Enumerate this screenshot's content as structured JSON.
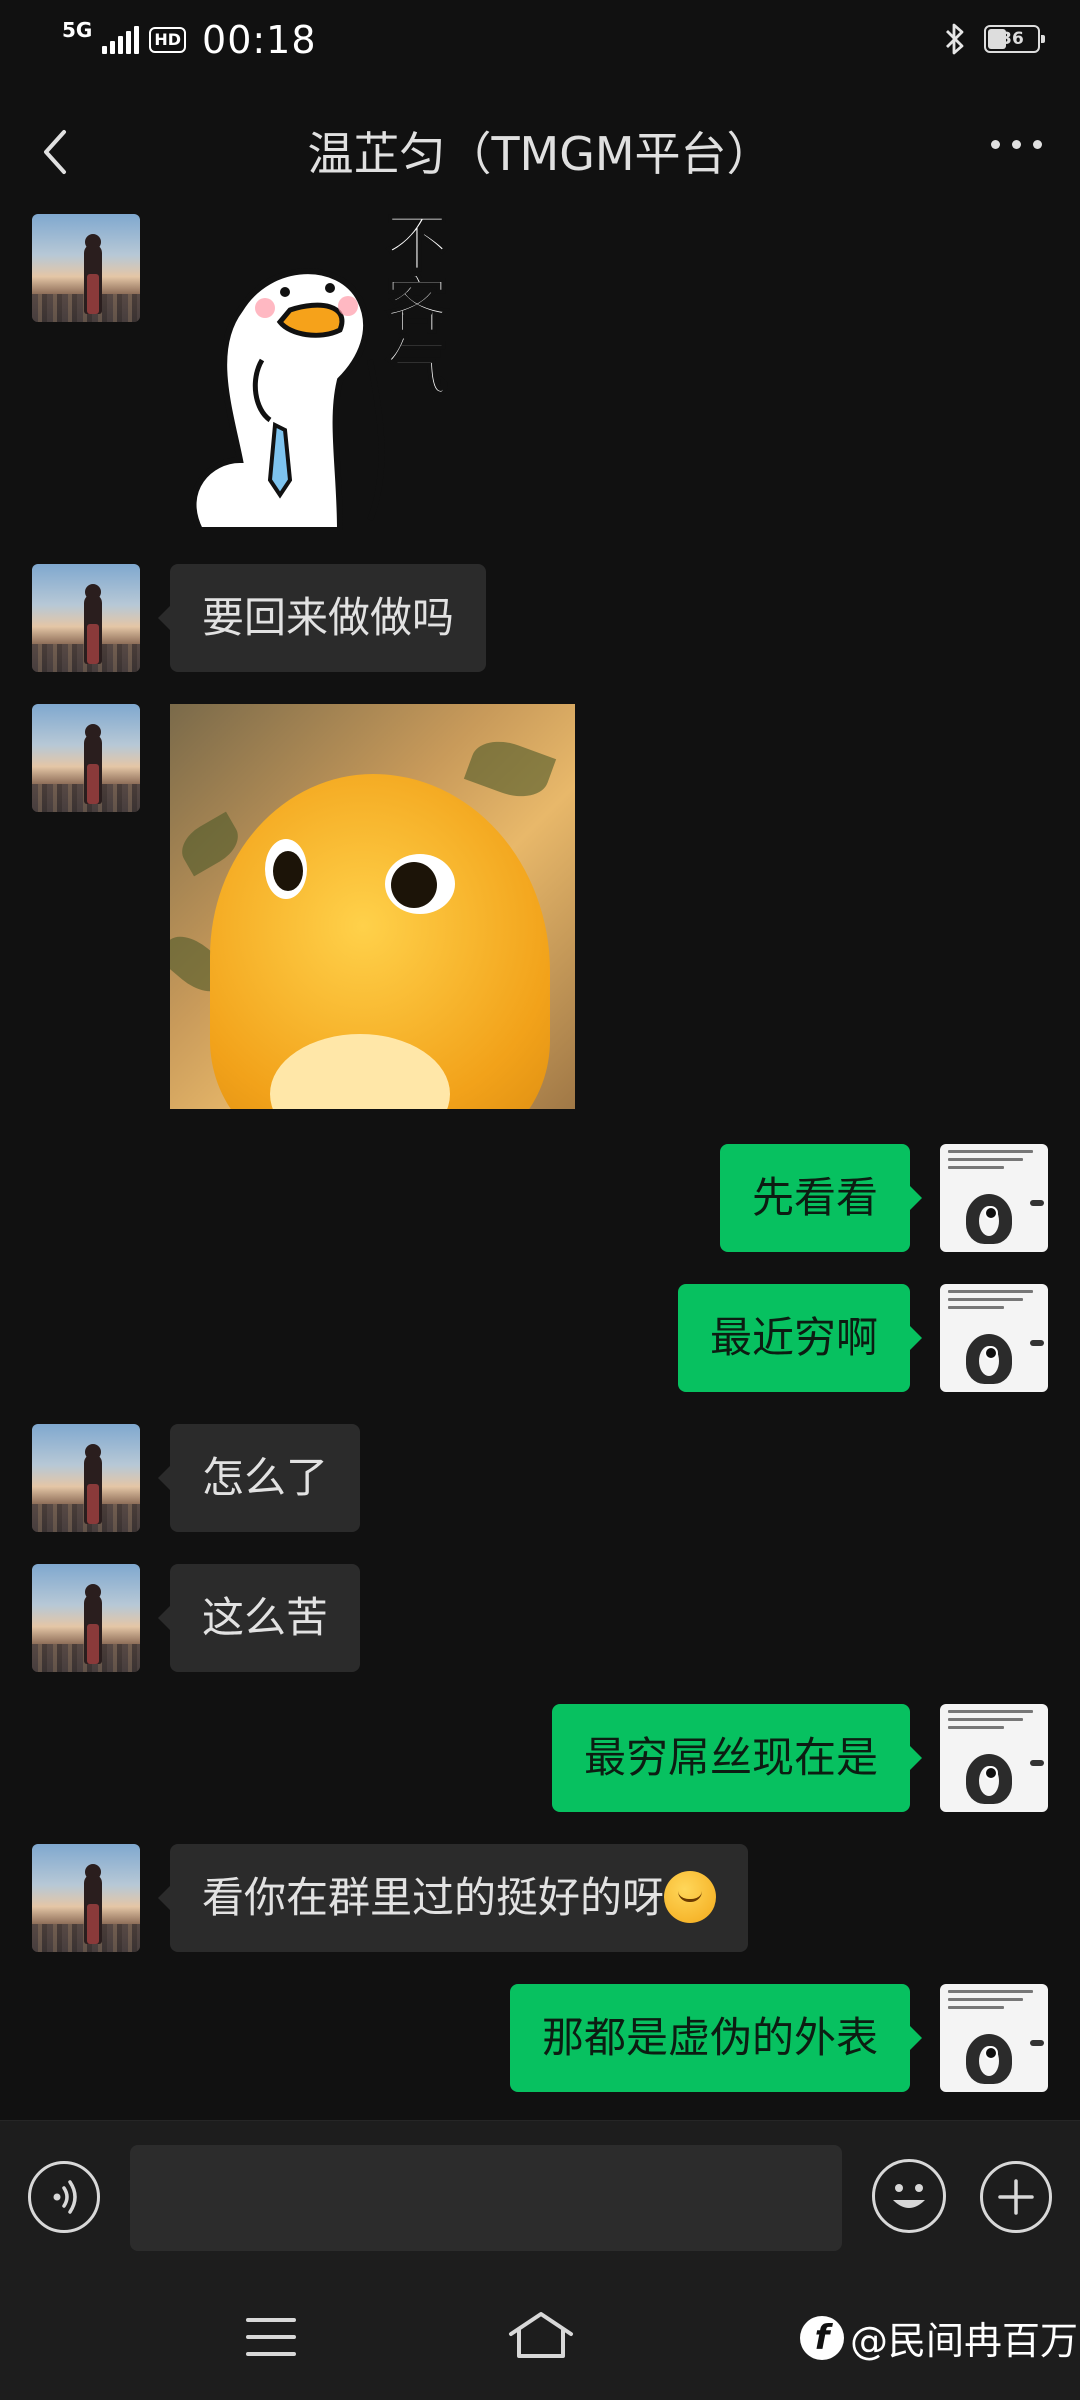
{
  "status_bar": {
    "network": "5G",
    "hd": "HD",
    "time": "00:18",
    "battery": "36"
  },
  "header": {
    "title": "温芷匀（TMGM平台）"
  },
  "messages": [
    {
      "side": "left",
      "type": "sticker",
      "sticker_icon": "duck-thanks-sticker",
      "sticker_text": "不客气"
    },
    {
      "side": "left",
      "type": "text",
      "text": "要回来做做吗"
    },
    {
      "side": "left",
      "type": "sticker",
      "sticker_icon": "yellow-duck-sticker"
    },
    {
      "side": "right",
      "type": "text",
      "text": "先看看"
    },
    {
      "side": "right",
      "type": "text",
      "text": "最近穷啊"
    },
    {
      "side": "left",
      "type": "text",
      "text": "怎么了"
    },
    {
      "side": "left",
      "type": "text",
      "text": "这么苦"
    },
    {
      "side": "right",
      "type": "text",
      "text": "最穷屌丝现在是"
    },
    {
      "side": "left",
      "type": "text",
      "text": "看你在群里过的挺好的呀",
      "emoji": "smirk-emoji"
    },
    {
      "side": "right",
      "type": "text",
      "text": "那都是虚伪的外表"
    }
  ],
  "input_bar": {
    "text_value": ""
  },
  "watermark": {
    "text": "@民间冉百万"
  },
  "colors": {
    "background": "#111111",
    "bubble_left": "#2b2b2b",
    "bubble_right": "#07c160"
  }
}
